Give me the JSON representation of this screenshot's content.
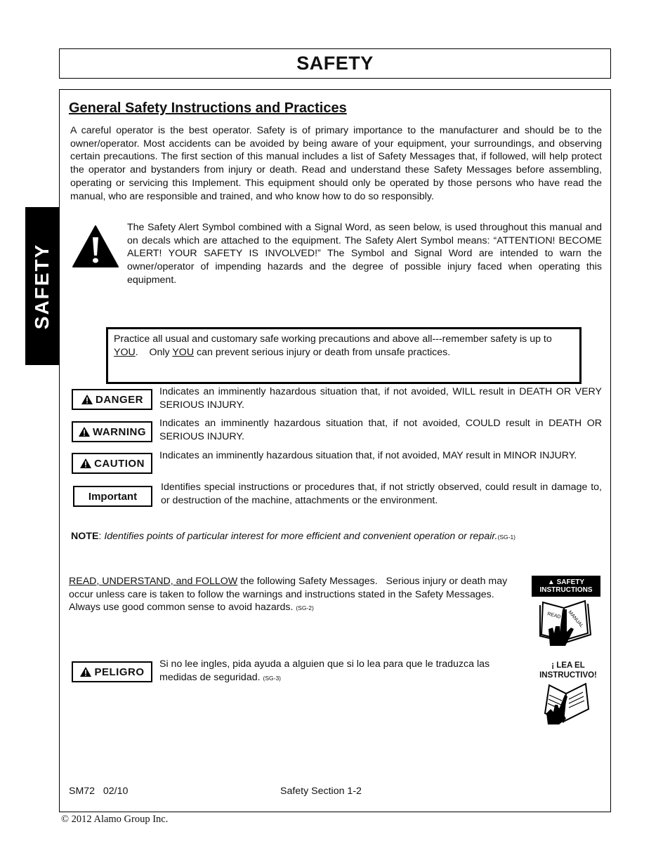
{
  "header": {
    "title": "SAFETY"
  },
  "side_tab": {
    "label": "SAFETY"
  },
  "section": {
    "heading": "General Safety Instructions and Practices",
    "intro": "A careful operator is the best operator. Safety is of primary importance to the manufacturer and should be to the owner/operator. Most accidents can be avoided by being aware of your equipment, your surroundings, and observing certain precautions. The first section of this manual includes a list of Safety Messages that, if followed, will help protect the operator and bystanders from injury or death. Read and understand these Safety Messages before assembling, operating or servicing this Implement. This equipment should only be operated by those persons who have read the manual, who are responsible and trained, and who know how to do so responsibly.",
    "alert_icon": "safety-alert-triangle-icon",
    "alert_paragraph": "The Safety Alert Symbol combined with a Signal Word, as seen below, is used throughout this manual and on decals which are attached to the equipment. The Safety Alert Symbol means: “ATTENTION! BECOME ALERT! YOUR SAFETY IS INVOLVED!” The Symbol and Signal Word are intended to warn the owner/operator of impending hazards and the degree of possible injury faced when operating this equipment."
  },
  "practice_box": {
    "line1": "Practice all usual and customary safe working precautions and above all---remember safety is up to ",
    "you1": "YOU",
    "mid": ".    Only ",
    "you2": "YOU",
    "end": " can prevent serious injury or death from unsafe practices."
  },
  "signal_words": [
    {
      "label": "DANGER",
      "icon": "alert-triangle-icon",
      "description": "Indicates an imminently hazardous situation that, if not avoided, WILL result in DEATH OR VERY SERIOUS INJURY."
    },
    {
      "label": "WARNING",
      "icon": "alert-triangle-icon",
      "description": "Indicates an imminently hazardous situation that, if not avoided, COULD result in DEATH OR SERIOUS INJURY."
    },
    {
      "label": "CAUTION",
      "icon": "alert-triangle-icon",
      "description": "Indicates an imminently hazardous situation that, if not avoided, MAY result in MINOR INJURY."
    },
    {
      "label": "Important",
      "icon": "",
      "description": "Identifies special instructions or procedures that, if not strictly observed, could result in damage to, or destruction of the machine, attachments or the environment."
    }
  ],
  "note": {
    "label": "NOTE",
    "text": "Identifies points of particular interest for more efficient and convenient operation or repair.",
    "ref": "(SG-1)"
  },
  "read_follow": {
    "underlined": "READ, UNDERSTAND, and FOLLOW",
    "text": " the following Safety Messages.   Serious injury or death may occur unless care is taken to follow the warnings and instructions stated in the Safety Messages.   Always use good common sense to avoid hazards. ",
    "ref": "(SG-2)",
    "decal_title_line1": "SAFETY",
    "decal_title_line2": "INSTRUCTIONS",
    "decal_icon": "read-manual-hand-icon"
  },
  "peligro": {
    "label": "PELIGRO",
    "text": "Si no lee ingles, pida ayuda a alguien que si lo lea para que le traduzca las medidas de seguridad. ",
    "ref": "(SG-3)",
    "decal_line1": "¡ LEA EL",
    "decal_line2": "INSTRUCTIVO!",
    "decal_icon": "read-manual-hand-icon"
  },
  "footer": {
    "doc_id": "SM72   02/10",
    "section": "Safety Section 1-2",
    "copyright": "© 2012 Alamo Group Inc."
  }
}
